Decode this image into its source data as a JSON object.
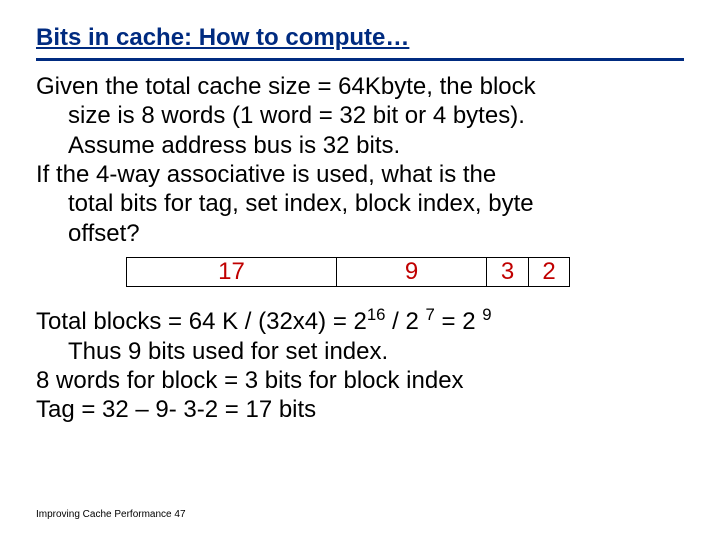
{
  "title": "Bits in cache: How to compute…",
  "p1_l1": "Given the total cache size = 64Kbyte, the block",
  "p1_l2": "size is 8 words (1 word = 32 bit or 4 bytes).",
  "p1_l3": "Assume address bus is 32 bits.",
  "p2_l1": "If the 4-way associative is used,  what is the",
  "p2_l2": "total bits for tag, set index, block index, byte",
  "p2_l3": "offset?",
  "diagram": {
    "tag": "17",
    "set": "9",
    "blk": "3",
    "byte": "2"
  },
  "calc": {
    "blocks_prefix": "Total blocks = 64 K / (32x4) = 2",
    "exp1": "16",
    "mid": " / 2 ",
    "exp2": "7",
    "eq": " = 2 ",
    "exp3": "9",
    "thus": "Thus 9 bits used for set index.",
    "words": "8 words for block = 3 bits for block index",
    "tagline": "Tag = 32 – 9- 3-2 = 17 bits"
  },
  "footer": "Improving Cache Performance 47"
}
